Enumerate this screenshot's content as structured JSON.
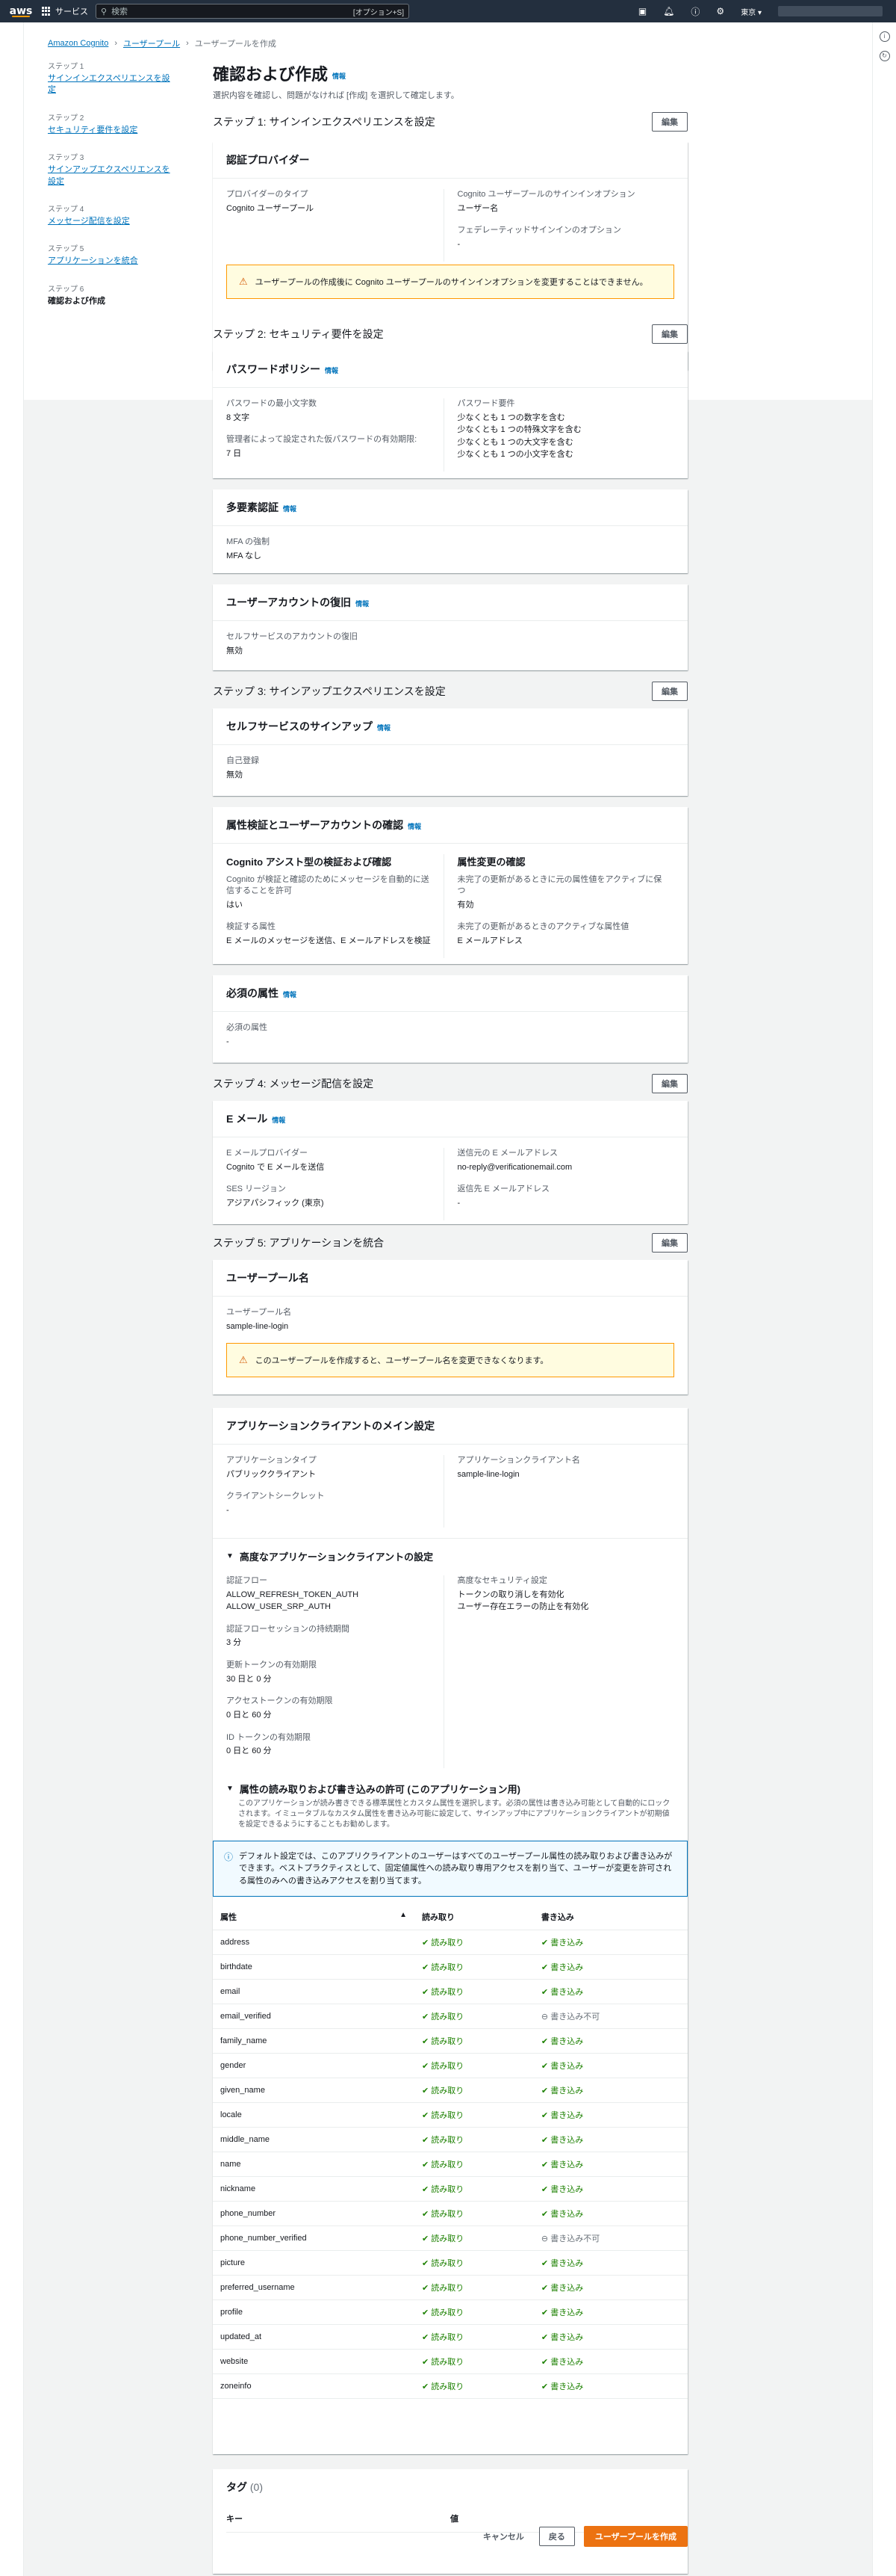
{
  "nav": {
    "logo": "aws",
    "services": "サービス",
    "search_placeholder": "検索",
    "search_shortcut": "[オプション+S]",
    "region": "東京"
  },
  "breadcrumb": [
    "Amazon Cognito",
    "ユーザープール",
    "ユーザープールを作成"
  ],
  "steps": [
    {
      "num": "ステップ 1",
      "label": "サインインエクスペリエンスを設定"
    },
    {
      "num": "ステップ 2",
      "label": "セキュリティ要件を設定"
    },
    {
      "num": "ステップ 3",
      "label": "サインアップエクスペリエンスを設定"
    },
    {
      "num": "ステップ 4",
      "label": "メッセージ配信を設定"
    },
    {
      "num": "ステップ 5",
      "label": "アプリケーションを統合"
    },
    {
      "num": "ステップ 6",
      "label": "確認および作成"
    }
  ],
  "page": {
    "title": "確認および作成",
    "info": "情報",
    "subtitle": "選択内容を確認し、問題がなければ [作成] を選択して確定します。",
    "edit": "編集"
  },
  "step1": {
    "title": "ステップ 1: サインインエクスペリエンスを設定",
    "card": "認証プロバイダー",
    "provider_type_k": "プロバイダーのタイプ",
    "provider_type_v": "Cognito ユーザープール",
    "signin_opt_k": "Cognito ユーザープールのサインインオプション",
    "signin_opt_v": "ユーザー名",
    "fed_k": "フェデレーティッドサインインのオプション",
    "fed_v": "-",
    "warn": "ユーザープールの作成後に Cognito ユーザープールのサインインオプションを変更することはできません。"
  },
  "step2": {
    "title": "ステップ 2: セキュリティ要件を設定",
    "pw_card": "パスワードポリシー",
    "min_len_k": "パスワードの最小文字数",
    "min_len_v": "8 文字",
    "temp_k": "管理者によって設定された仮パスワードの有効期限:",
    "temp_v": "7 日",
    "req_k": "パスワード要件",
    "req_v": [
      "少なくとも 1 つの数字を含む",
      "少なくとも 1 つの特殊文字を含む",
      "少なくとも 1 つの大文字を含む",
      "少なくとも 1 つの小文字を含む"
    ],
    "mfa_card": "多要素認証",
    "mfa_k": "MFA の強制",
    "mfa_v": "MFA なし",
    "rec_card": "ユーザーアカウントの復旧",
    "rec_k": "セルフサービスのアカウントの復旧",
    "rec_v": "無効"
  },
  "step3": {
    "title": "ステップ 3: サインアップエクスペリエンスを設定",
    "self_card": "セルフサービスのサインアップ",
    "self_k": "自己登録",
    "self_v": "無効",
    "attr_card": "属性検証とユーザーアカウントの確認",
    "assist_h": "Cognito アシスト型の検証および確認",
    "assist_k": "Cognito が検証と確認のためにメッセージを自動的に送信することを許可",
    "assist_v": "はい",
    "verify_k": "検証する属性",
    "verify_v": "E メールのメッセージを送信、E メールアドレスを検証",
    "change_h": "属性変更の確認",
    "keep_k": "未完了の更新があるときに元の属性値をアクティブに保つ",
    "keep_v": "有効",
    "active_k": "未完了の更新があるときのアクティブな属性値",
    "active_v": "E メールアドレス",
    "req_card": "必須の属性",
    "req_k": "必須の属性",
    "req_v": "-"
  },
  "step4": {
    "title": "ステップ 4: メッセージ配信を設定",
    "card": "E メール",
    "prov_k": "E メールプロバイダー",
    "prov_v": "Cognito で E メールを送信",
    "ses_k": "SES リージョン",
    "ses_v": "アジアパシフィック (東京)",
    "from_k": "送信元の E メールアドレス",
    "from_v": "no-reply@verificationemail.com",
    "reply_k": "返信先 E メールアドレス",
    "reply_v": "-"
  },
  "step5": {
    "title": "ステップ 5: アプリケーションを統合",
    "pool_card": "ユーザープール名",
    "pool_k": "ユーザープール名",
    "pool_v": "sample-line-login",
    "pool_warn": "このユーザープールを作成すると、ユーザープール名を変更できなくなります。",
    "client_card": "アプリケーションクライアントのメイン設定",
    "type_k": "アプリケーションタイプ",
    "type_v": "パブリッククライアント",
    "secret_k": "クライアントシークレット",
    "secret_v": "-",
    "name_k": "アプリケーションクライアント名",
    "name_v": "sample-line-login",
    "adv_h": "高度なアプリケーションクライアントの設定",
    "flow_k": "認証フロー",
    "flow_v": [
      "ALLOW_REFRESH_TOKEN_AUTH",
      "ALLOW_USER_SRP_AUTH"
    ],
    "session_k": "認証フローセッションの持続期間",
    "session_v": "3 分",
    "refresh_k": "更新トークンの有効期限",
    "refresh_v": "30 日と 0 分",
    "access_k": "アクセストークンの有効期限",
    "access_v": "0 日と 60 分",
    "id_k": "ID トークンの有効期限",
    "id_v": "0 日と 60 分",
    "sec_k": "高度なセキュリティ設定",
    "sec_v": [
      "トークンの取り消しを有効化",
      "ユーザー存在エラーの防止を有効化"
    ],
    "perm_h": "属性の読み取りおよび書き込みの許可 (このアプリケーション用)",
    "perm_lead": "このアプリケーションが読み書きできる標準属性とカスタム属性を選択します。必須の属性は書き込み可能として自動的にロックされます。イミュータブルなカスタム属性を書き込み可能に設定して、サインアップ中にアプリケーションクライアントが初期値を設定できるようにすることもお勧めします。",
    "perm_info": "デフォルト設定では、このアプリクライアントのユーザーはすべてのユーザープール属性の読み取りおよび書き込みができます。ベストプラクティスとして、固定値属性への読み取り専用アクセスを割り当て、ユーザーが変更を許可される属性のみへの書き込みアクセスを割り当てます。",
    "cols": [
      "属性",
      "読み取り",
      "書き込み"
    ],
    "rows": [
      {
        "a": "address",
        "r": "読み取り",
        "w": "書き込み",
        "wo": true
      },
      {
        "a": "birthdate",
        "r": "読み取り",
        "w": "書き込み",
        "wo": true
      },
      {
        "a": "email",
        "r": "読み取り",
        "w": "書き込み",
        "wo": true
      },
      {
        "a": "email_verified",
        "r": "読み取り",
        "w": "書き込み不可",
        "wo": false
      },
      {
        "a": "family_name",
        "r": "読み取り",
        "w": "書き込み",
        "wo": true
      },
      {
        "a": "gender",
        "r": "読み取り",
        "w": "書き込み",
        "wo": true
      },
      {
        "a": "given_name",
        "r": "読み取り",
        "w": "書き込み",
        "wo": true
      },
      {
        "a": "locale",
        "r": "読み取り",
        "w": "書き込み",
        "wo": true
      },
      {
        "a": "middle_name",
        "r": "読み取り",
        "w": "書き込み",
        "wo": true
      },
      {
        "a": "name",
        "r": "読み取り",
        "w": "書き込み",
        "wo": true
      },
      {
        "a": "nickname",
        "r": "読み取り",
        "w": "書き込み",
        "wo": true
      },
      {
        "a": "phone_number",
        "r": "読み取り",
        "w": "書き込み",
        "wo": true
      },
      {
        "a": "phone_number_verified",
        "r": "読み取り",
        "w": "書き込み不可",
        "wo": false
      },
      {
        "a": "picture",
        "r": "読み取り",
        "w": "書き込み",
        "wo": true
      },
      {
        "a": "preferred_username",
        "r": "読み取り",
        "w": "書き込み",
        "wo": true
      },
      {
        "a": "profile",
        "r": "読み取り",
        "w": "書き込み",
        "wo": true
      },
      {
        "a": "updated_at",
        "r": "読み取り",
        "w": "書き込み",
        "wo": true
      },
      {
        "a": "website",
        "r": "読み取り",
        "w": "書き込み",
        "wo": true
      },
      {
        "a": "zoneinfo",
        "r": "読み取り",
        "w": "書き込み",
        "wo": true
      }
    ]
  },
  "tags": {
    "title": "タグ",
    "count": "(0)",
    "key": "キー",
    "value": "値"
  },
  "footer": {
    "cancel": "キャンセル",
    "back": "戻る",
    "create": "ユーザープールを作成"
  }
}
